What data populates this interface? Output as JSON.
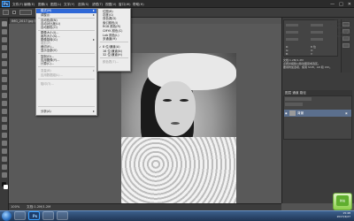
{
  "menubar": {
    "logo": "Ps",
    "items": [
      "文件(F)",
      "编辑(E)",
      "图像(I)",
      "图层(L)",
      "文字(Y)",
      "选择(S)",
      "滤镜(T)",
      "视图(V)",
      "窗口(W)",
      "帮助(H)"
    ]
  },
  "doc_tab": "IMG_2017.jpg @ 100%",
  "menu_image": {
    "items": [
      {
        "label": "模式(M)",
        "shortcut": "",
        "submenu": true,
        "highlighted": true
      },
      {
        "label": "调整(J)",
        "shortcut": "",
        "submenu": true
      },
      {
        "sep": true
      },
      {
        "label": "自动色调(N)",
        "shortcut": "Shift+Ctrl+L"
      },
      {
        "label": "自动对比度(U)",
        "shortcut": "Alt+Shift+Ctrl+L"
      },
      {
        "label": "自动颜色(O)",
        "shortcut": "Shift+Ctrl+B"
      },
      {
        "sep": true
      },
      {
        "label": "图像大小(I)...",
        "shortcut": "Alt+Ctrl+I"
      },
      {
        "label": "画布大小(S)...",
        "shortcut": "Alt+Ctrl+C"
      },
      {
        "label": "图像旋转(G)",
        "shortcut": "",
        "submenu": true
      },
      {
        "label": "裁剪(P)",
        "shortcut": "",
        "dim": true
      },
      {
        "label": "裁切(R)...",
        "shortcut": ""
      },
      {
        "label": "显示全部(V)",
        "shortcut": ""
      },
      {
        "sep": true
      },
      {
        "label": "复制(D)...",
        "shortcut": ""
      },
      {
        "label": "应用图像(Y)...",
        "shortcut": ""
      },
      {
        "label": "计算(C)...",
        "shortcut": ""
      },
      {
        "sep": true
      },
      {
        "label": "变量(B)",
        "shortcut": "",
        "submenu": true,
        "dim": true
      },
      {
        "label": "应用数据组(L)...",
        "shortcut": "",
        "dim": true
      },
      {
        "sep": true
      },
      {
        "label": "陷印(T)...",
        "shortcut": "",
        "dim": true
      },
      {
        "sep": true
      },
      {
        "label": "分析(A)",
        "shortcut": "",
        "submenu": true
      }
    ]
  },
  "menu_mode": {
    "items": [
      {
        "label": "位图(B)",
        "checked": false
      },
      {
        "label": "灰度(G)",
        "checked": false
      },
      {
        "label": "双色调(D)",
        "checked": false
      },
      {
        "label": "索引颜色(I)",
        "checked": false
      },
      {
        "label": "RGB 颜色(R)",
        "checked": false
      },
      {
        "label": "CMYK 颜色(C)",
        "checked": false
      },
      {
        "label": "Lab 颜色(L)",
        "checked": false
      },
      {
        "label": "多通道(M)",
        "checked": false
      },
      {
        "sep": true
      },
      {
        "label": "8 位/通道(A)",
        "checked": true
      },
      {
        "label": "16 位/通道(N)",
        "checked": false
      },
      {
        "label": "32 位/通道(H)",
        "checked": false
      },
      {
        "sep": true
      },
      {
        "label": "颜色表(T)...",
        "checked": false,
        "dim": true
      }
    ]
  },
  "panels": {
    "info_lines": [
      "R:",
      "G:",
      "B:",
      "8 位",
      "X:",
      "Y:",
      "文档:1.2M/1.2M",
      "点按并拖移以移动图层或选区。",
      "要用附加选项，使用 Shift、Alt 和 Ctrl。"
    ],
    "layers_tabs": "图层  通道  路径",
    "layer_name": "背景"
  },
  "status": {
    "zoom": "100%",
    "text": "文档:1.2M/1.2M"
  },
  "taskbar": {
    "buttons": [
      "",
      "Ps",
      "",
      ""
    ],
    "tray_time": "15:48",
    "tray_date": "2017/4/27"
  },
  "badge": "新站",
  "colors": {
    "menu_highlight": "#2f68d6",
    "app_bg": "#535353",
    "taskbar": "#2a4a75"
  }
}
